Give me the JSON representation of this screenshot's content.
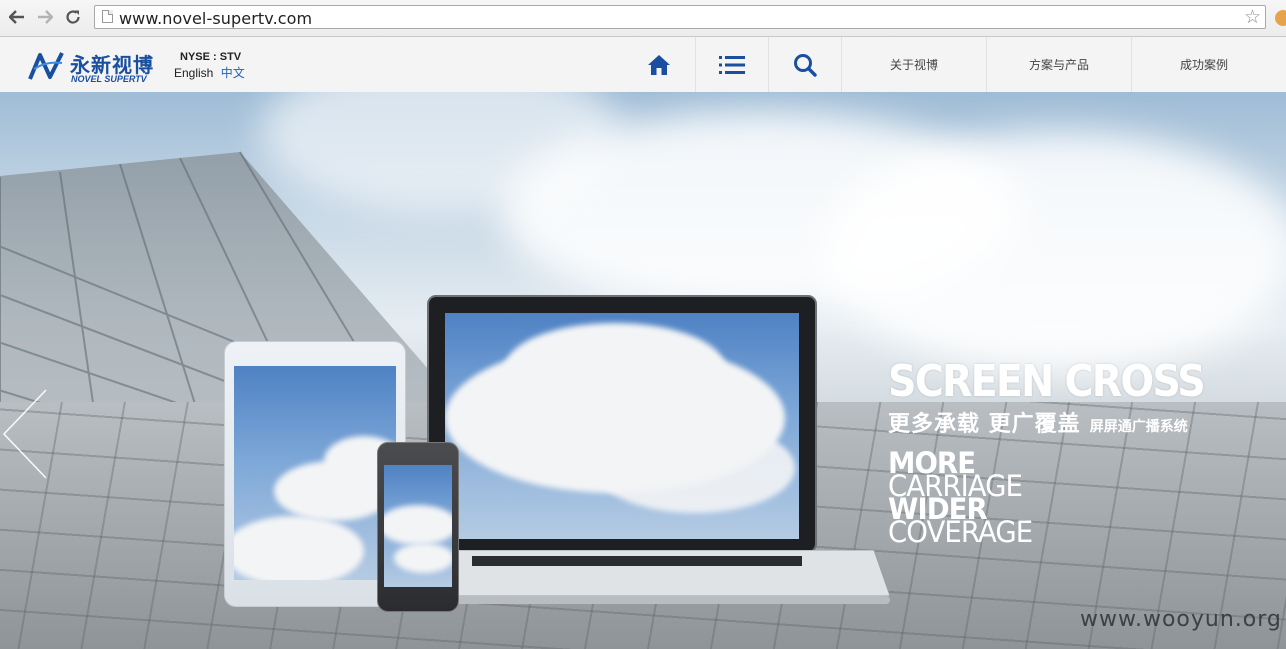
{
  "browser": {
    "url": "www.novel-supertv.com",
    "back_icon": "arrow-left-icon",
    "forward_icon": "arrow-right-icon",
    "reload_icon": "reload-icon",
    "bookmark_icon": "star-icon"
  },
  "header": {
    "logo_cn": "永新视博",
    "logo_en": "NOVEL SUPERTV",
    "stock": "NYSE : STV",
    "lang_en": "English",
    "lang_cn": "中文",
    "nav_icons": [
      "home-icon",
      "list-icon",
      "search-icon"
    ],
    "nav_links": [
      "关于视博",
      "方案与产品",
      "成功案例"
    ],
    "brand_color": "#1a4fa0"
  },
  "hero": {
    "headline": "SCREEN CROSS",
    "cn_main": "更多承载 更广覆盖",
    "cn_sub": "屏屏通广播系统",
    "words": [
      "MORE",
      "CARRIAGE",
      "WIDER",
      "COVERAGE"
    ],
    "watermark": "www.wooyun.org"
  }
}
